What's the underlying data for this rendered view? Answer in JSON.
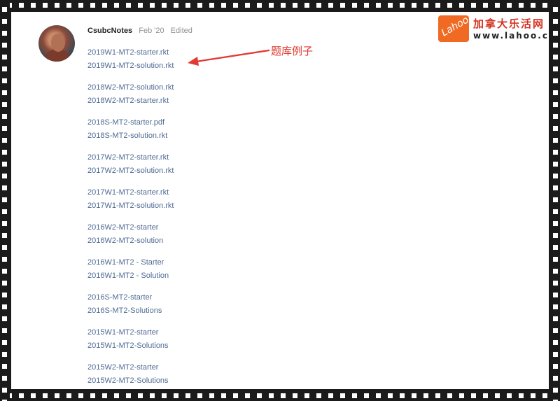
{
  "post": {
    "author": "CsubcNotes",
    "date": "Feb '20",
    "edited": "Edited"
  },
  "annotation": {
    "text": "题库例子",
    "color": "#e03a32"
  },
  "watermark": {
    "logo": "Lahoo",
    "cn": "加拿大乐活网",
    "url": "www.lahoo.ca"
  },
  "file_groups": [
    {
      "files": [
        "2019W1-MT2-starter.rkt",
        "2019W1-MT2-solution.rkt"
      ]
    },
    {
      "files": [
        "2018W2-MT2-solution.rkt",
        "2018W2-MT2-starter.rkt"
      ]
    },
    {
      "files": [
        "2018S-MT2-starter.pdf",
        "2018S-MT2-solution.rkt"
      ]
    },
    {
      "files": [
        "2017W2-MT2-starter.rkt",
        "2017W2-MT2-solution.rkt"
      ]
    },
    {
      "files": [
        "2017W1-MT2-starter.rkt",
        "2017W1-MT2-solution.rkt"
      ]
    },
    {
      "files": [
        "2016W2-MT2-starter",
        "2016W2-MT2-solution"
      ]
    },
    {
      "files": [
        "2016W1-MT2 - Starter",
        "2016W1-MT2 - Solution"
      ]
    },
    {
      "files": [
        "2016S-MT2-starter",
        "2016S-MT2-Solutions"
      ]
    },
    {
      "files": [
        "2015W1-MT2-starter",
        "2015W1-MT2-Solutions"
      ]
    },
    {
      "files": [
        "2015W2-MT2-starter",
        "2015W2-MT2-Solutions"
      ]
    }
  ],
  "colors": {
    "link": "#4f6a93",
    "author": "#222222",
    "muted": "#919191"
  }
}
